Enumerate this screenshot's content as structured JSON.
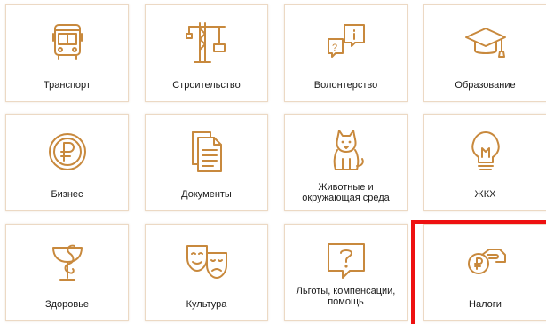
{
  "accent_color": "#c8893d",
  "highlight_color": "#ee1111",
  "tiles": [
    {
      "label": "Транспорт",
      "icon": "bus-icon"
    },
    {
      "label": "Строительство",
      "icon": "crane-icon"
    },
    {
      "label": "Волонтерство",
      "icon": "speech-bubbles-info-icon"
    },
    {
      "label": "Образование",
      "icon": "graduation-cap-icon"
    },
    {
      "label": "Бизнес",
      "icon": "ruble-coin-icon"
    },
    {
      "label": "Документы",
      "icon": "documents-icon"
    },
    {
      "label": "Животные и окружающая среда",
      "icon": "dog-icon"
    },
    {
      "label": "ЖКХ",
      "icon": "light-bulb-icon"
    },
    {
      "label": "Здоровье",
      "icon": "medical-bowl-snake-icon"
    },
    {
      "label": "Культура",
      "icon": "theater-masks-icon"
    },
    {
      "label": "Льготы, компенсации, помощь",
      "icon": "question-bubble-icon"
    },
    {
      "label": "Налоги",
      "icon": "hand-coin-icon"
    }
  ]
}
